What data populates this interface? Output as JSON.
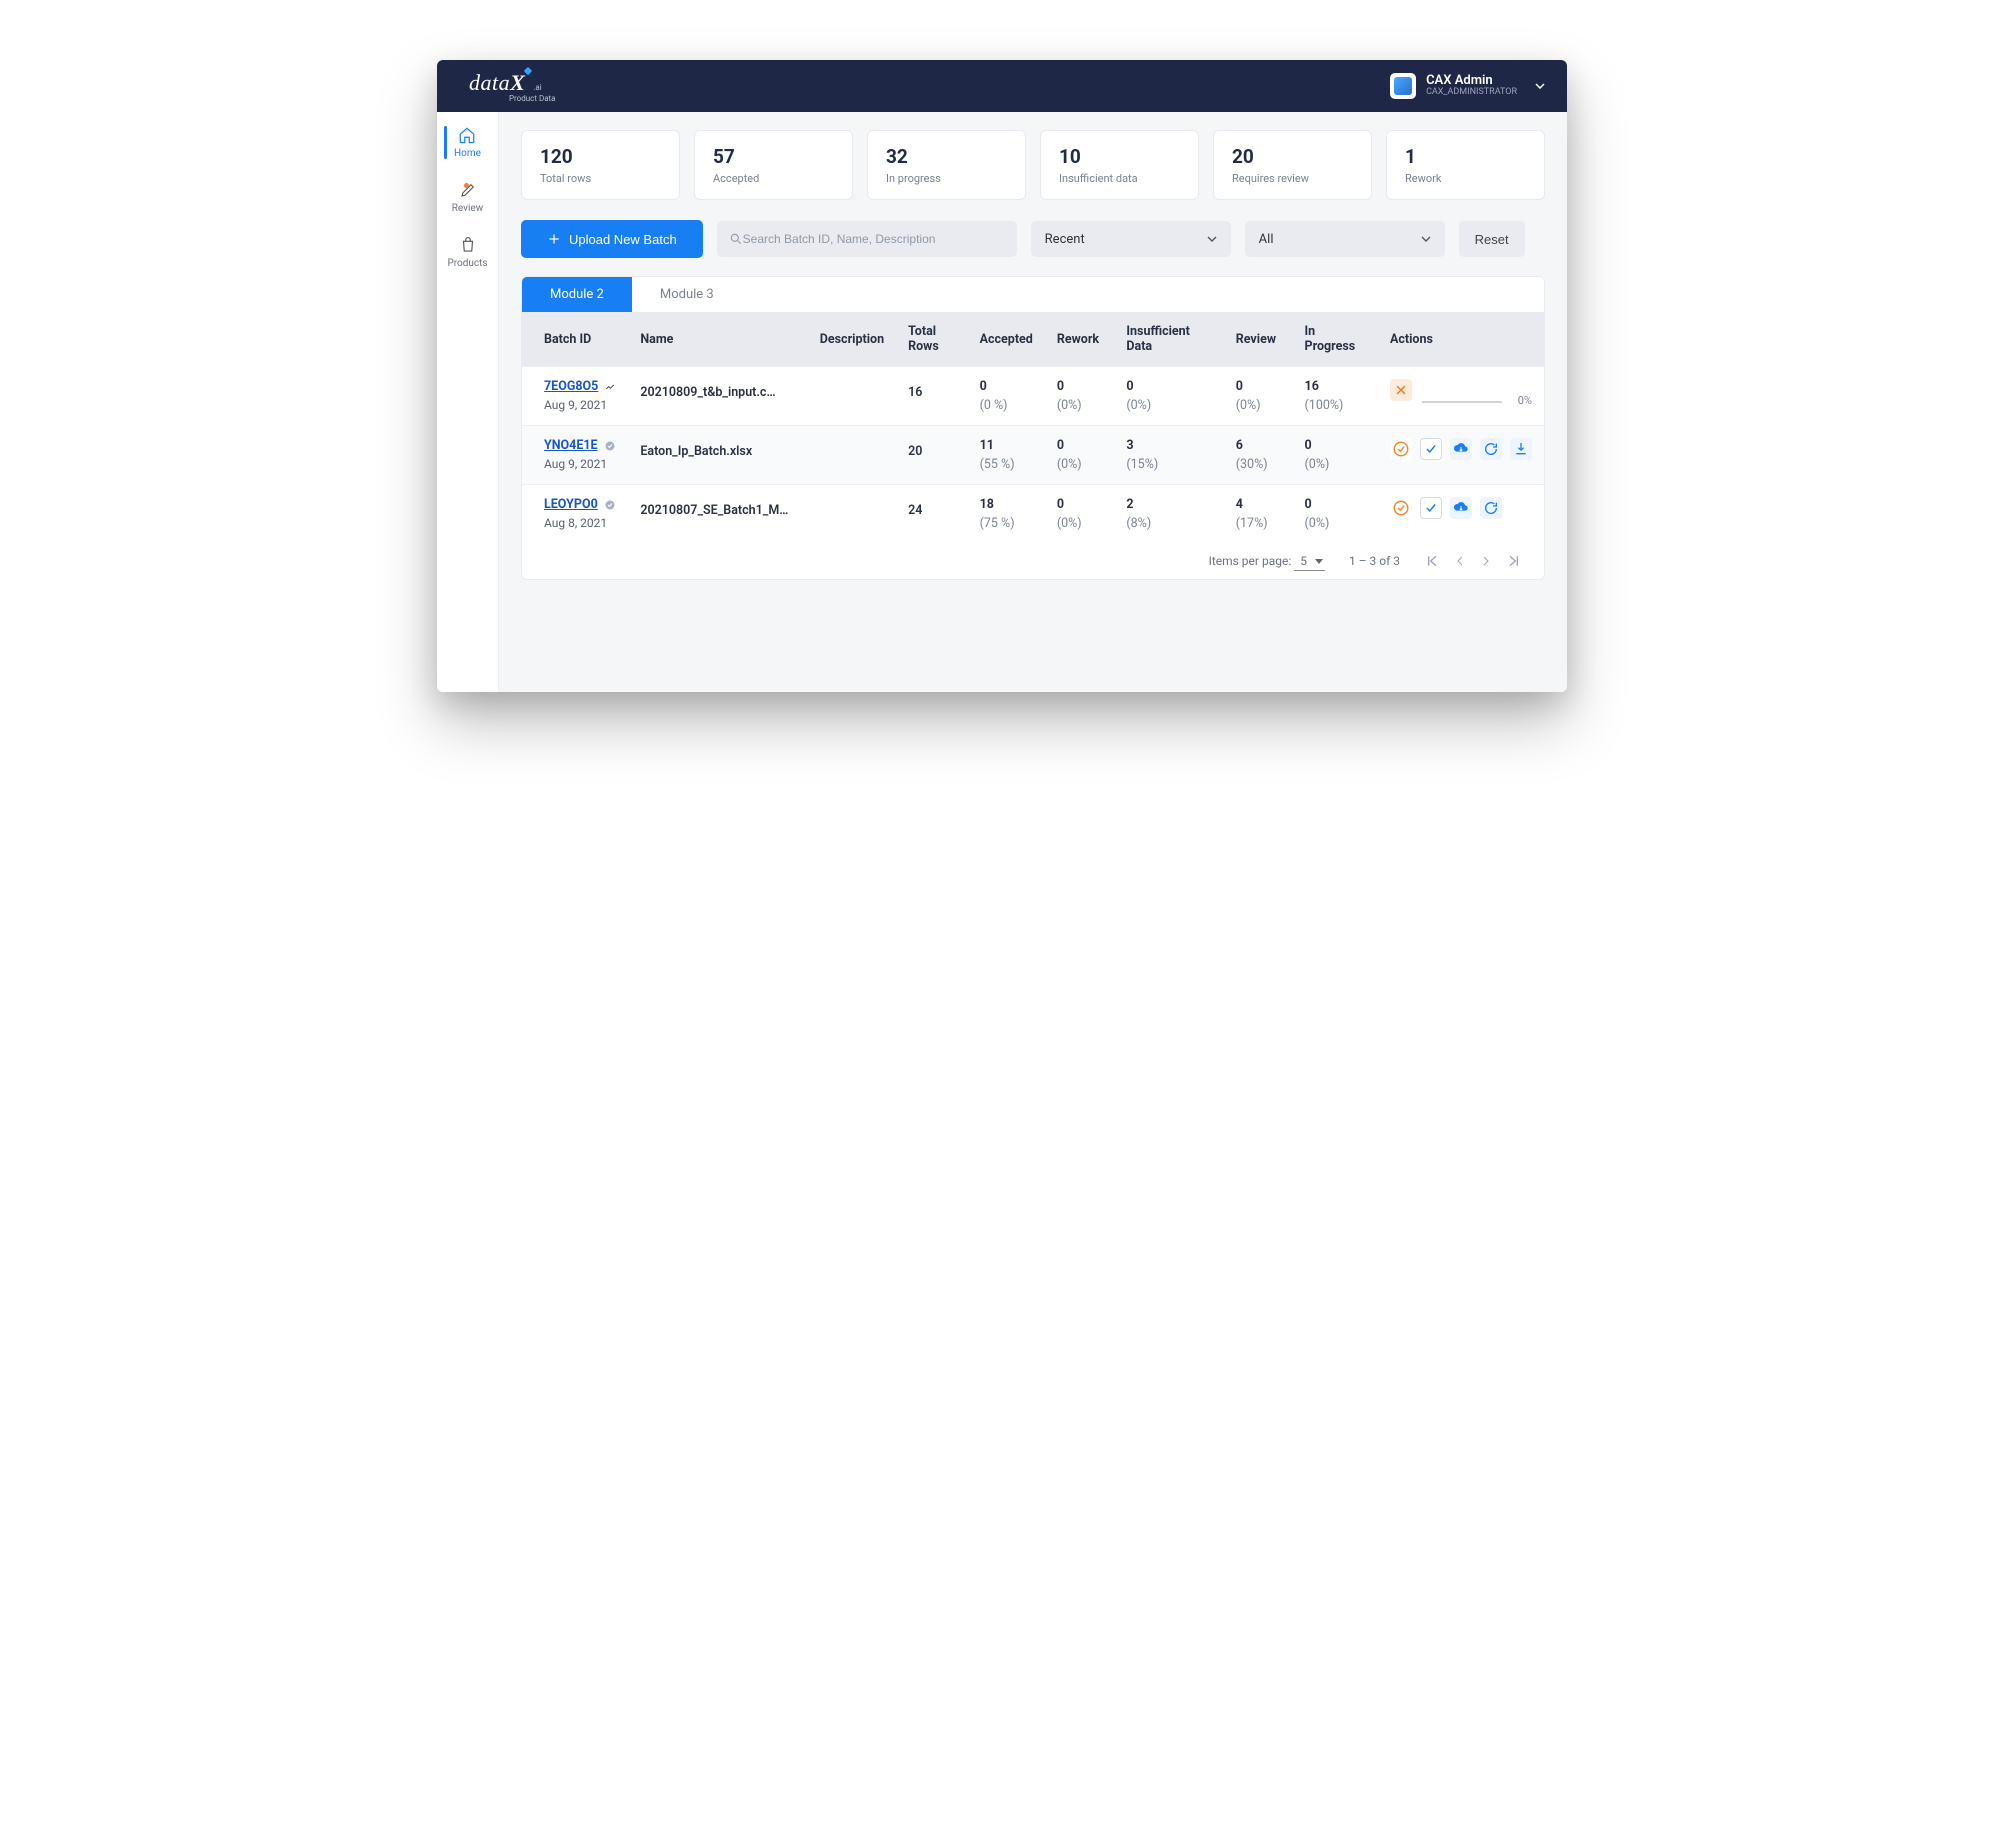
{
  "brand": {
    "name": "dataX",
    "suffix": ".ai",
    "tagline": "Product Data"
  },
  "user": {
    "name": "CAX Admin",
    "role": "CAX_ADMINISTRATOR"
  },
  "nav": {
    "home": "Home",
    "review": "Review",
    "products": "Products"
  },
  "stats": {
    "total_rows": {
      "value": "120",
      "label": "Total rows"
    },
    "accepted": {
      "value": "57",
      "label": "Accepted"
    },
    "in_progress": {
      "value": "32",
      "label": "In progress"
    },
    "insufficient": {
      "value": "10",
      "label": "Insufficient data"
    },
    "requires_review": {
      "value": "20",
      "label": "Requires review"
    },
    "rework": {
      "value": "1",
      "label": "Rework"
    }
  },
  "controls": {
    "upload_label": "Upload New Batch",
    "search_placeholder": "Search Batch ID, Name, Description",
    "sort_value": "Recent",
    "filter_value": "All",
    "reset_label": "Reset"
  },
  "tabs": {
    "t1": "Module 2",
    "t2": "Module 3"
  },
  "columns": {
    "batch_id": "Batch ID",
    "name": "Name",
    "description": "Description",
    "total_rows": "Total Rows",
    "accepted": "Accepted",
    "rework": "Rework",
    "insufficient": "Insufficient Data",
    "review": "Review",
    "in_progress": "In Progress",
    "actions": "Actions"
  },
  "rows": [
    {
      "id": "7EOG8O5",
      "date": "Aug 9, 2021",
      "status_icon": "trending",
      "name": "20210809_t&b_input.c…",
      "description": "",
      "total": "16",
      "accepted": "0",
      "accepted_pct": "(0 %)",
      "rework": "0",
      "rework_pct": "(0%)",
      "insufficient": "0",
      "insufficient_pct": "(0%)",
      "review": "0",
      "review_pct": "(0%)",
      "inprogress": "16",
      "inprogress_pct": "(100%)",
      "progress_pct": "0%"
    },
    {
      "id": "YNO4E1E",
      "date": "Aug 9, 2021",
      "status_icon": "verified",
      "name": "Eaton_Ip_Batch.xlsx",
      "description": "",
      "total": "20",
      "accepted": "11",
      "accepted_pct": "(55 %)",
      "rework": "0",
      "rework_pct": "(0%)",
      "insufficient": "3",
      "insufficient_pct": "(15%)",
      "review": "6",
      "review_pct": "(30%)",
      "inprogress": "0",
      "inprogress_pct": "(0%)"
    },
    {
      "id": "LEOYPO0",
      "date": "Aug 8, 2021",
      "status_icon": "verified",
      "name": "20210807_SE_Batch1_M…",
      "description": "",
      "total": "24",
      "accepted": "18",
      "accepted_pct": "(75 %)",
      "rework": "0",
      "rework_pct": "(0%)",
      "insufficient": "2",
      "insufficient_pct": "(8%)",
      "review": "4",
      "review_pct": "(17%)",
      "inprogress": "0",
      "inprogress_pct": "(0%)"
    }
  ],
  "pager": {
    "items_per_page_label": "Items per page:",
    "page_size": "5",
    "range_text": "1 – 3 of 3"
  }
}
